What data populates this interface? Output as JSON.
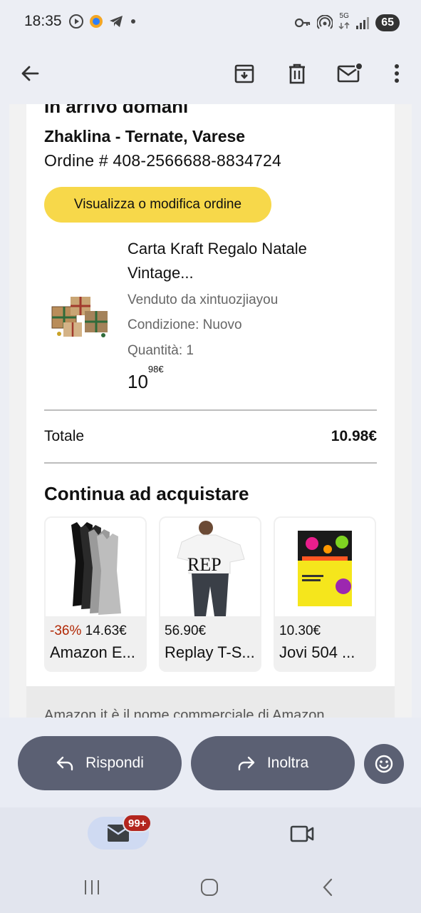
{
  "status_bar": {
    "time": "18:35",
    "network": "5G",
    "battery": "65",
    "left_icons": [
      "play-icon",
      "app-icon",
      "telegram-icon",
      "dot-icon"
    ],
    "right_icons": [
      "key-icon",
      "hotspot-icon",
      "5g-icon",
      "signal-icon",
      "battery-icon"
    ]
  },
  "app_bar": {
    "icons": [
      "back-arrow-icon",
      "archive-icon",
      "trash-icon",
      "mark-unread-icon",
      "more-vert-icon"
    ]
  },
  "email": {
    "heading_partial": "In arrivo domani",
    "address": "Zhaklina - Ternate, Varese",
    "order_number": "Ordine # 408-2566688-8834724",
    "order_button": "Visualizza o modifica ordine",
    "product": {
      "title": "Carta Kraft Regalo Natale Vintage...",
      "seller": "Venduto da xintuozjiayou",
      "condition": "Condizione: Nuovo",
      "quantity": "Quantità: 1",
      "price_main": "10",
      "price_sup": "98€"
    },
    "total_label": "Totale",
    "total_value": "10.98€",
    "continue_heading": "Continua ad acquistare",
    "recommendations": [
      {
        "discount": "-36%",
        "price": "14.63€",
        "name": "Amazon E..."
      },
      {
        "discount": "",
        "price": "56.90€",
        "name": "Replay T-S..."
      },
      {
        "discount": "",
        "price": "10.30€",
        "name": "Jovi 504 ..."
      }
    ],
    "footer_partial": "Amazon.it è il nome commerciale di Amazon"
  },
  "actions": {
    "reply_label": "Rispondi",
    "forward_label": "Inoltra",
    "emoji_icon": "emoji-icon"
  },
  "bottom_nav": {
    "mail_badge": "99+",
    "mail_icon": "mail-icon",
    "video_icon": "video-icon"
  },
  "system_nav": {
    "icons": [
      "recents-icon",
      "home-icon",
      "back-icon"
    ]
  },
  "colors": {
    "order_button": "#f7d84a",
    "discount": "#b12704",
    "action_pill": "#5b6073",
    "badge": "#b3261e",
    "mail_tab": "#cfdaf2"
  }
}
